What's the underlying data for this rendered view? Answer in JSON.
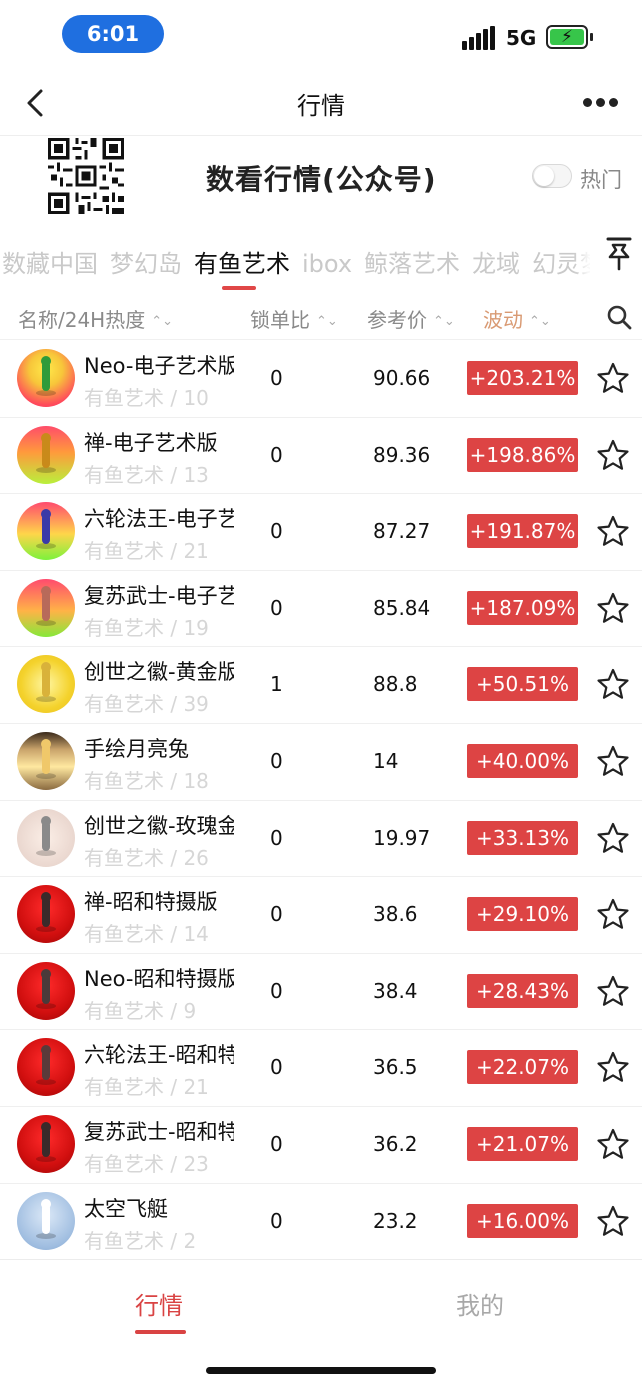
{
  "status_bar": {
    "time": "6:01",
    "network": "5G"
  },
  "nav": {
    "title": "行情"
  },
  "banner": {
    "title": "数看行情(公众号)",
    "toggle_label": "热门",
    "toggle_on": false
  },
  "platform_tabs": [
    {
      "label": "数藏中国",
      "active": false
    },
    {
      "label": "梦幻岛",
      "active": false
    },
    {
      "label": "有鱼艺术",
      "active": true
    },
    {
      "label": "ibox",
      "active": false
    },
    {
      "label": "鲸落艺术",
      "active": false
    },
    {
      "label": "龙域",
      "active": false
    },
    {
      "label": "幻灵梦",
      "active": false
    }
  ],
  "columns": {
    "name": "名称/24H热度",
    "lock": "锁单比",
    "price": "参考价",
    "wave": "波动"
  },
  "rows": [
    {
      "name": "Neo-电子艺术版",
      "platform": "有鱼艺术",
      "heat": "10",
      "lock": "0",
      "price": "90.66",
      "change": "+203.21%"
    },
    {
      "name": "禅-电子艺术版",
      "platform": "有鱼艺术",
      "heat": "13",
      "lock": "0",
      "price": "89.36",
      "change": "+198.86%"
    },
    {
      "name": "六轮法王-电子艺术版",
      "platform": "有鱼艺术",
      "heat": "21",
      "lock": "0",
      "price": "87.27",
      "change": "+191.87%"
    },
    {
      "name": "复苏武士-电子艺术版",
      "platform": "有鱼艺术",
      "heat": "19",
      "lock": "0",
      "price": "85.84",
      "change": "+187.09%"
    },
    {
      "name": "创世之徽-黄金版",
      "platform": "有鱼艺术",
      "heat": "39",
      "lock": "1",
      "price": "88.8",
      "change": "+50.51%"
    },
    {
      "name": "手绘月亮兔",
      "platform": "有鱼艺术",
      "heat": "18",
      "lock": "0",
      "price": "14",
      "change": "+40.00%"
    },
    {
      "name": "创世之徽-玫瑰金版",
      "platform": "有鱼艺术",
      "heat": "26",
      "lock": "0",
      "price": "19.97",
      "change": "+33.13%"
    },
    {
      "name": "禅-昭和特摄版",
      "platform": "有鱼艺术",
      "heat": "14",
      "lock": "0",
      "price": "38.6",
      "change": "+29.10%"
    },
    {
      "name": "Neo-昭和特摄版",
      "platform": "有鱼艺术",
      "heat": "9",
      "lock": "0",
      "price": "38.4",
      "change": "+28.43%"
    },
    {
      "name": "六轮法王-昭和特摄版",
      "platform": "有鱼艺术",
      "heat": "21",
      "lock": "0",
      "price": "36.5",
      "change": "+22.07%"
    },
    {
      "name": "复苏武士-昭和特摄版",
      "platform": "有鱼艺术",
      "heat": "23",
      "lock": "0",
      "price": "36.2",
      "change": "+21.07%"
    },
    {
      "name": "太空飞艇",
      "platform": "有鱼艺术",
      "heat": "2",
      "lock": "0",
      "price": "23.2",
      "change": "+16.00%"
    }
  ],
  "tab_bar": {
    "quote": "行情",
    "mine": "我的"
  },
  "colors": {
    "accent": "#d94343",
    "change_bg": "#dd4444",
    "time_pill": "#1f6fe0",
    "battery": "#37c54a"
  }
}
